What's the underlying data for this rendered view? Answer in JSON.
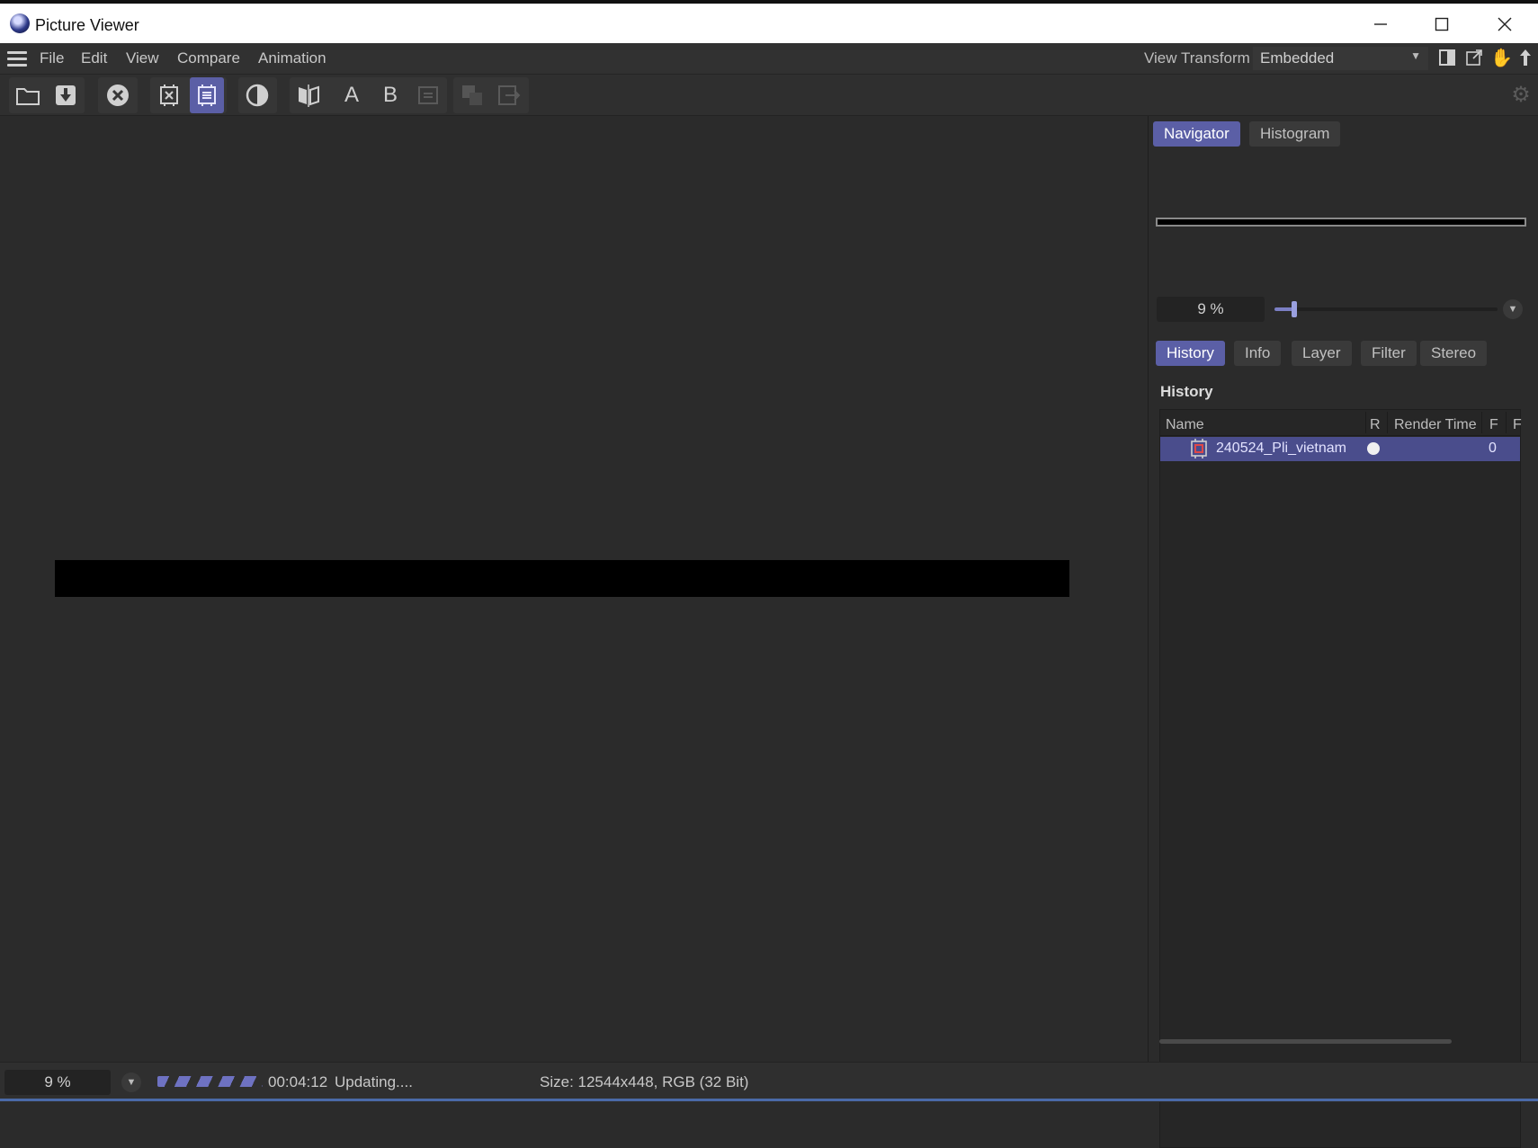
{
  "window": {
    "title": "Picture Viewer"
  },
  "menu": {
    "items": [
      "File",
      "Edit",
      "View",
      "Compare",
      "Animation"
    ]
  },
  "view_transform": {
    "label": "View Transform",
    "value": "Embedded"
  },
  "toolbar": {
    "buttons": [
      {
        "icon": "open-folder-icon"
      },
      {
        "icon": "save-icon"
      },
      {
        "icon": "stop-render-icon"
      },
      {
        "icon": "render-region-icon"
      },
      {
        "icon": "render-full-icon",
        "active": true
      },
      {
        "icon": "contrast-icon"
      },
      {
        "icon": "ab-compare-icon"
      },
      {
        "icon": "a-label",
        "text": "A"
      },
      {
        "icon": "b-label",
        "text": "B"
      },
      {
        "icon": "swap-icon",
        "disabled": true
      },
      {
        "icon": "layers-icon",
        "disabled": true
      },
      {
        "icon": "export-icon",
        "disabled": true
      }
    ]
  },
  "navigator": {
    "tabs": [
      "Navigator",
      "Histogram"
    ],
    "active_tab": "Navigator",
    "zoom_label": "9 %",
    "zoom_percent": 9
  },
  "info_tabs": {
    "tabs": [
      "History",
      "Info",
      "Layer",
      "Filter",
      "Stereo"
    ],
    "active_tab": "History"
  },
  "history": {
    "title": "History",
    "columns": [
      "Name",
      "R",
      "Render Time",
      "F",
      "F"
    ],
    "rows": [
      {
        "name": "240524_Pli_vietnam",
        "render_time": "",
        "frame": "0"
      }
    ]
  },
  "status": {
    "zoom": "9 %",
    "time": "00:04:12",
    "message": "Updating....",
    "size": "Size: 12544x448, RGB (32 Bit)"
  },
  "colors": {
    "accent": "#5b5fa6",
    "selected_row": "#4a4d8c",
    "background": "#2b2b2b"
  }
}
